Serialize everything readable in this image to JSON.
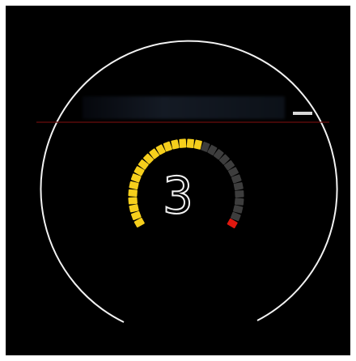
{
  "header": {
    "info_text": ""
  },
  "gauge": {
    "gear": "3",
    "segments_total": 30,
    "segments_lit": 17,
    "redline_segments": 1,
    "colors": {
      "lit": "#f6cf1c",
      "unlit": "#3d3d3d",
      "redline": "#e0180f",
      "outer_ring": "#f2f2f2",
      "divider": "#6a0d0d",
      "indicator": "#d8d8d8",
      "background": "#000000"
    }
  }
}
